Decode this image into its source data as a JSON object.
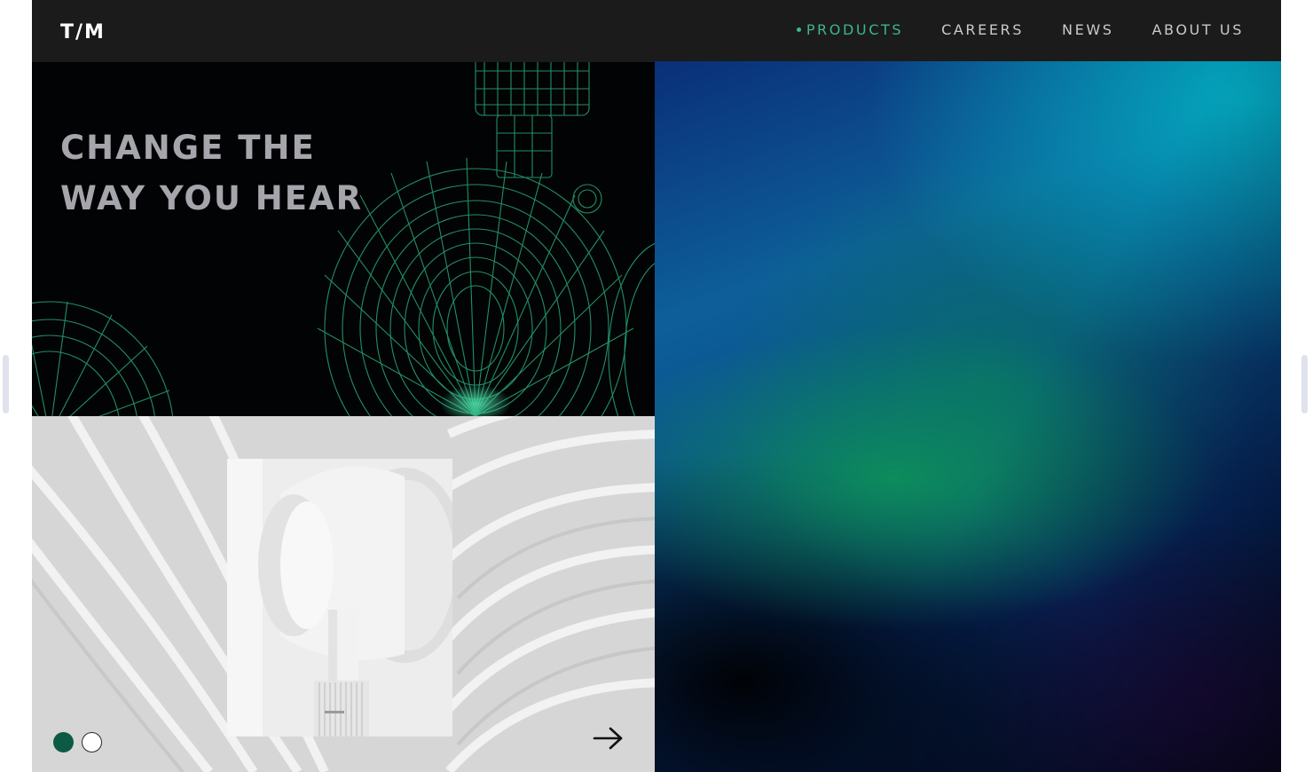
{
  "brand": {
    "logo_text": "T/M"
  },
  "nav": {
    "items": [
      {
        "label": "PRODUCTS",
        "active": true
      },
      {
        "label": "CAREERS",
        "active": false
      },
      {
        "label": "NEWS",
        "active": false
      },
      {
        "label": "ABOUT US",
        "active": false
      }
    ]
  },
  "hero": {
    "headline_line1": "CHANGE THE",
    "headline_line2": "WAY YOU HEAR",
    "image": "wireframe-headphones"
  },
  "product": {
    "image": "white-headphone-closeup",
    "background": "white-wave-architecture",
    "carousel": {
      "slides": 2,
      "active_slide": 1
    },
    "next_icon": "arrow-right-icon"
  },
  "colors": {
    "accent": "#3cb787",
    "active_dot": "#0d5a44",
    "navbar": "#1b1b1b",
    "headline": "#a5a5ab",
    "wireframe": "#2fbf8a"
  }
}
